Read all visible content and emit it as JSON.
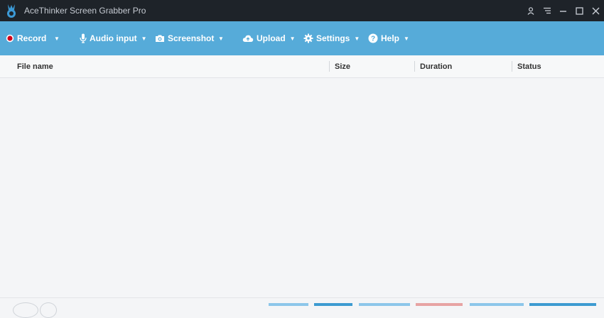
{
  "window": {
    "title": "AceThinker Screen Grabber Pro"
  },
  "toolbar": {
    "record_label": "Record",
    "audio_label": "Audio input",
    "screenshot_label": "Screenshot",
    "upload_label": "Upload",
    "settings_label": "Settings",
    "help_label": "Help"
  },
  "table": {
    "columns": [
      "File name",
      "Size",
      "Duration",
      "Status"
    ],
    "rows": []
  },
  "colors": {
    "titlebar_bg": "#1e2329",
    "toolbar_bg": "#56abd9",
    "record_dot": "#d0021b",
    "footer_buttons": [
      "#8cc6ea",
      "#3d9bd1",
      "#8cc6ea",
      "#e7a3a3",
      "#8cc6ea",
      "#3d9bd1"
    ]
  },
  "icons": {
    "logo": "acethinker-logo-icon",
    "user": "user-icon",
    "menu": "list-menu-icon",
    "minimize": "minimize-icon",
    "maximize": "maximize-icon",
    "close": "close-icon",
    "record": "record-dot-icon",
    "audio": "microphone-icon",
    "screenshot": "camera-icon",
    "upload": "cloud-upload-icon",
    "settings": "gear-icon",
    "help": "help-icon"
  }
}
